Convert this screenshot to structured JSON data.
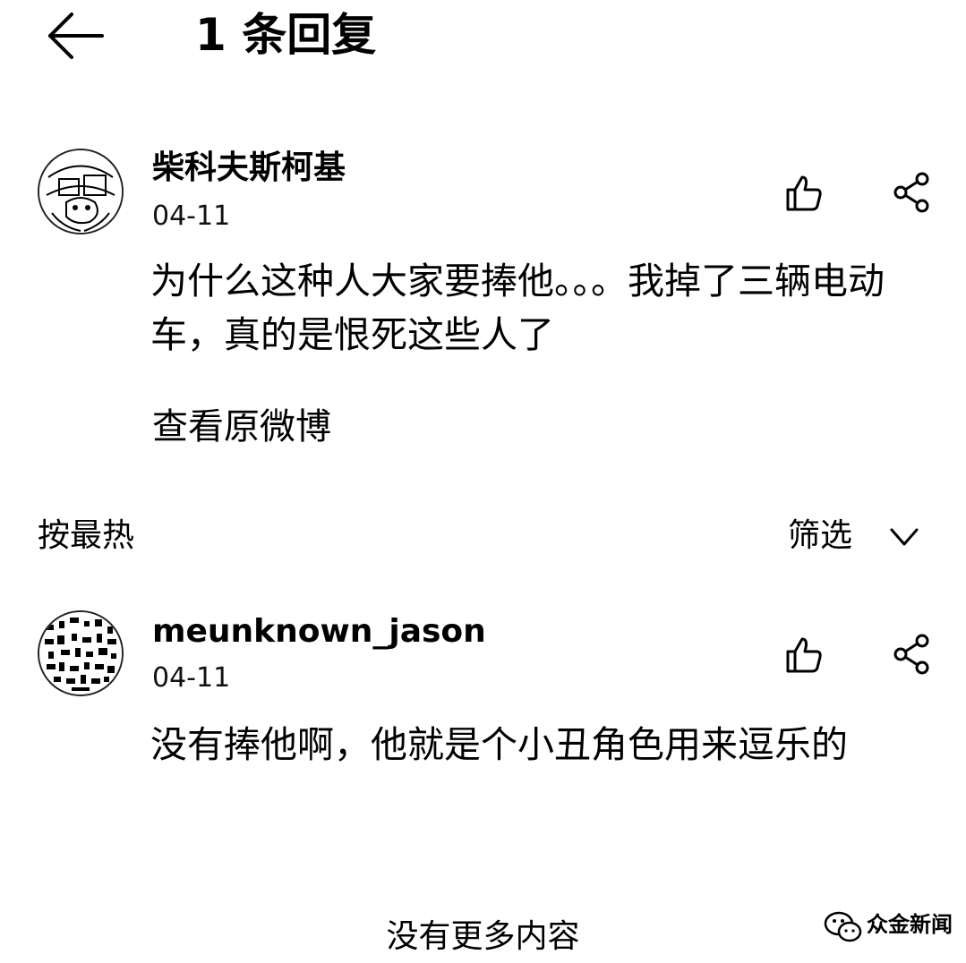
{
  "header": {
    "back_icon": "arrow-left-icon",
    "title": "1 条回复"
  },
  "root_comment": {
    "author": "柴科夫斯柯基",
    "date": "04-11",
    "text": "为什么这种人大家要捧他。。。我掉了三辆电动车，真的是恨死这些人了",
    "link": "查看原微博",
    "like_icon": "thumbs-up-icon",
    "share_icon": "share-icon"
  },
  "sort_bar": {
    "sort_label": "按最热",
    "filter_label": "筛选",
    "filter_icon": "chevron-down-icon"
  },
  "replies": [
    {
      "author": "meunknown_jason",
      "date": "04-11",
      "text": "没有捧他啊，他就是个小丑角色用来逗乐的",
      "like_icon": "thumbs-up-icon",
      "share_icon": "share-icon"
    }
  ],
  "footer": {
    "no_more": "没有更多内容"
  },
  "watermark": {
    "text": "众金新闻"
  }
}
